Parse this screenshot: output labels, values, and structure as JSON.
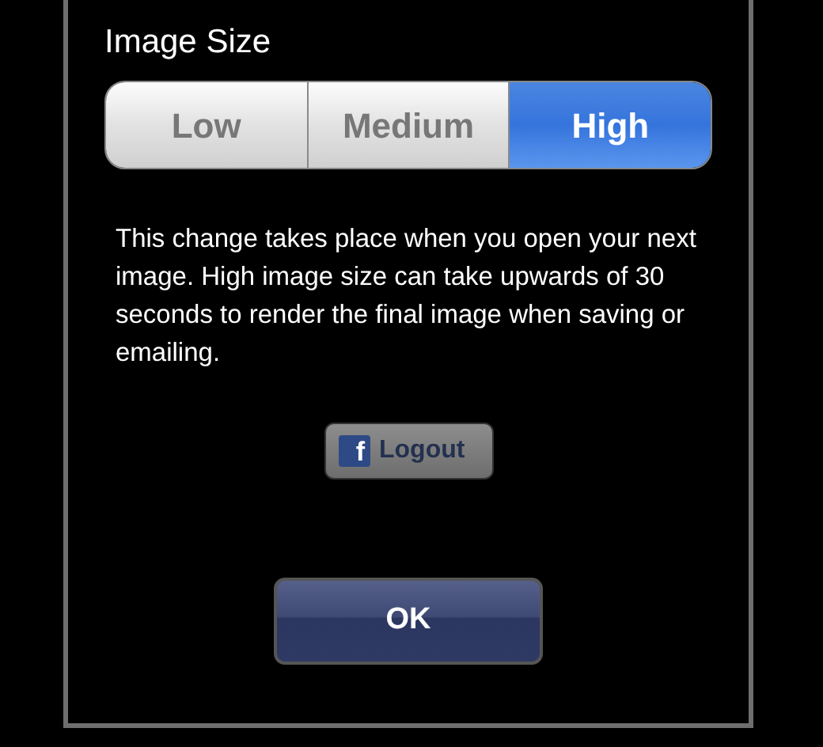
{
  "title": "Image Size",
  "segments": [
    {
      "label": "Low",
      "selected": false
    },
    {
      "label": "Medium",
      "selected": false
    },
    {
      "label": "High",
      "selected": true
    }
  ],
  "message": "This change takes place when you open your next image. High image size can take upwards of 30 seconds to render the final image when saving or emailing.",
  "logout_button": {
    "icon": "f",
    "label": "Logout"
  },
  "ok_button": "OK"
}
